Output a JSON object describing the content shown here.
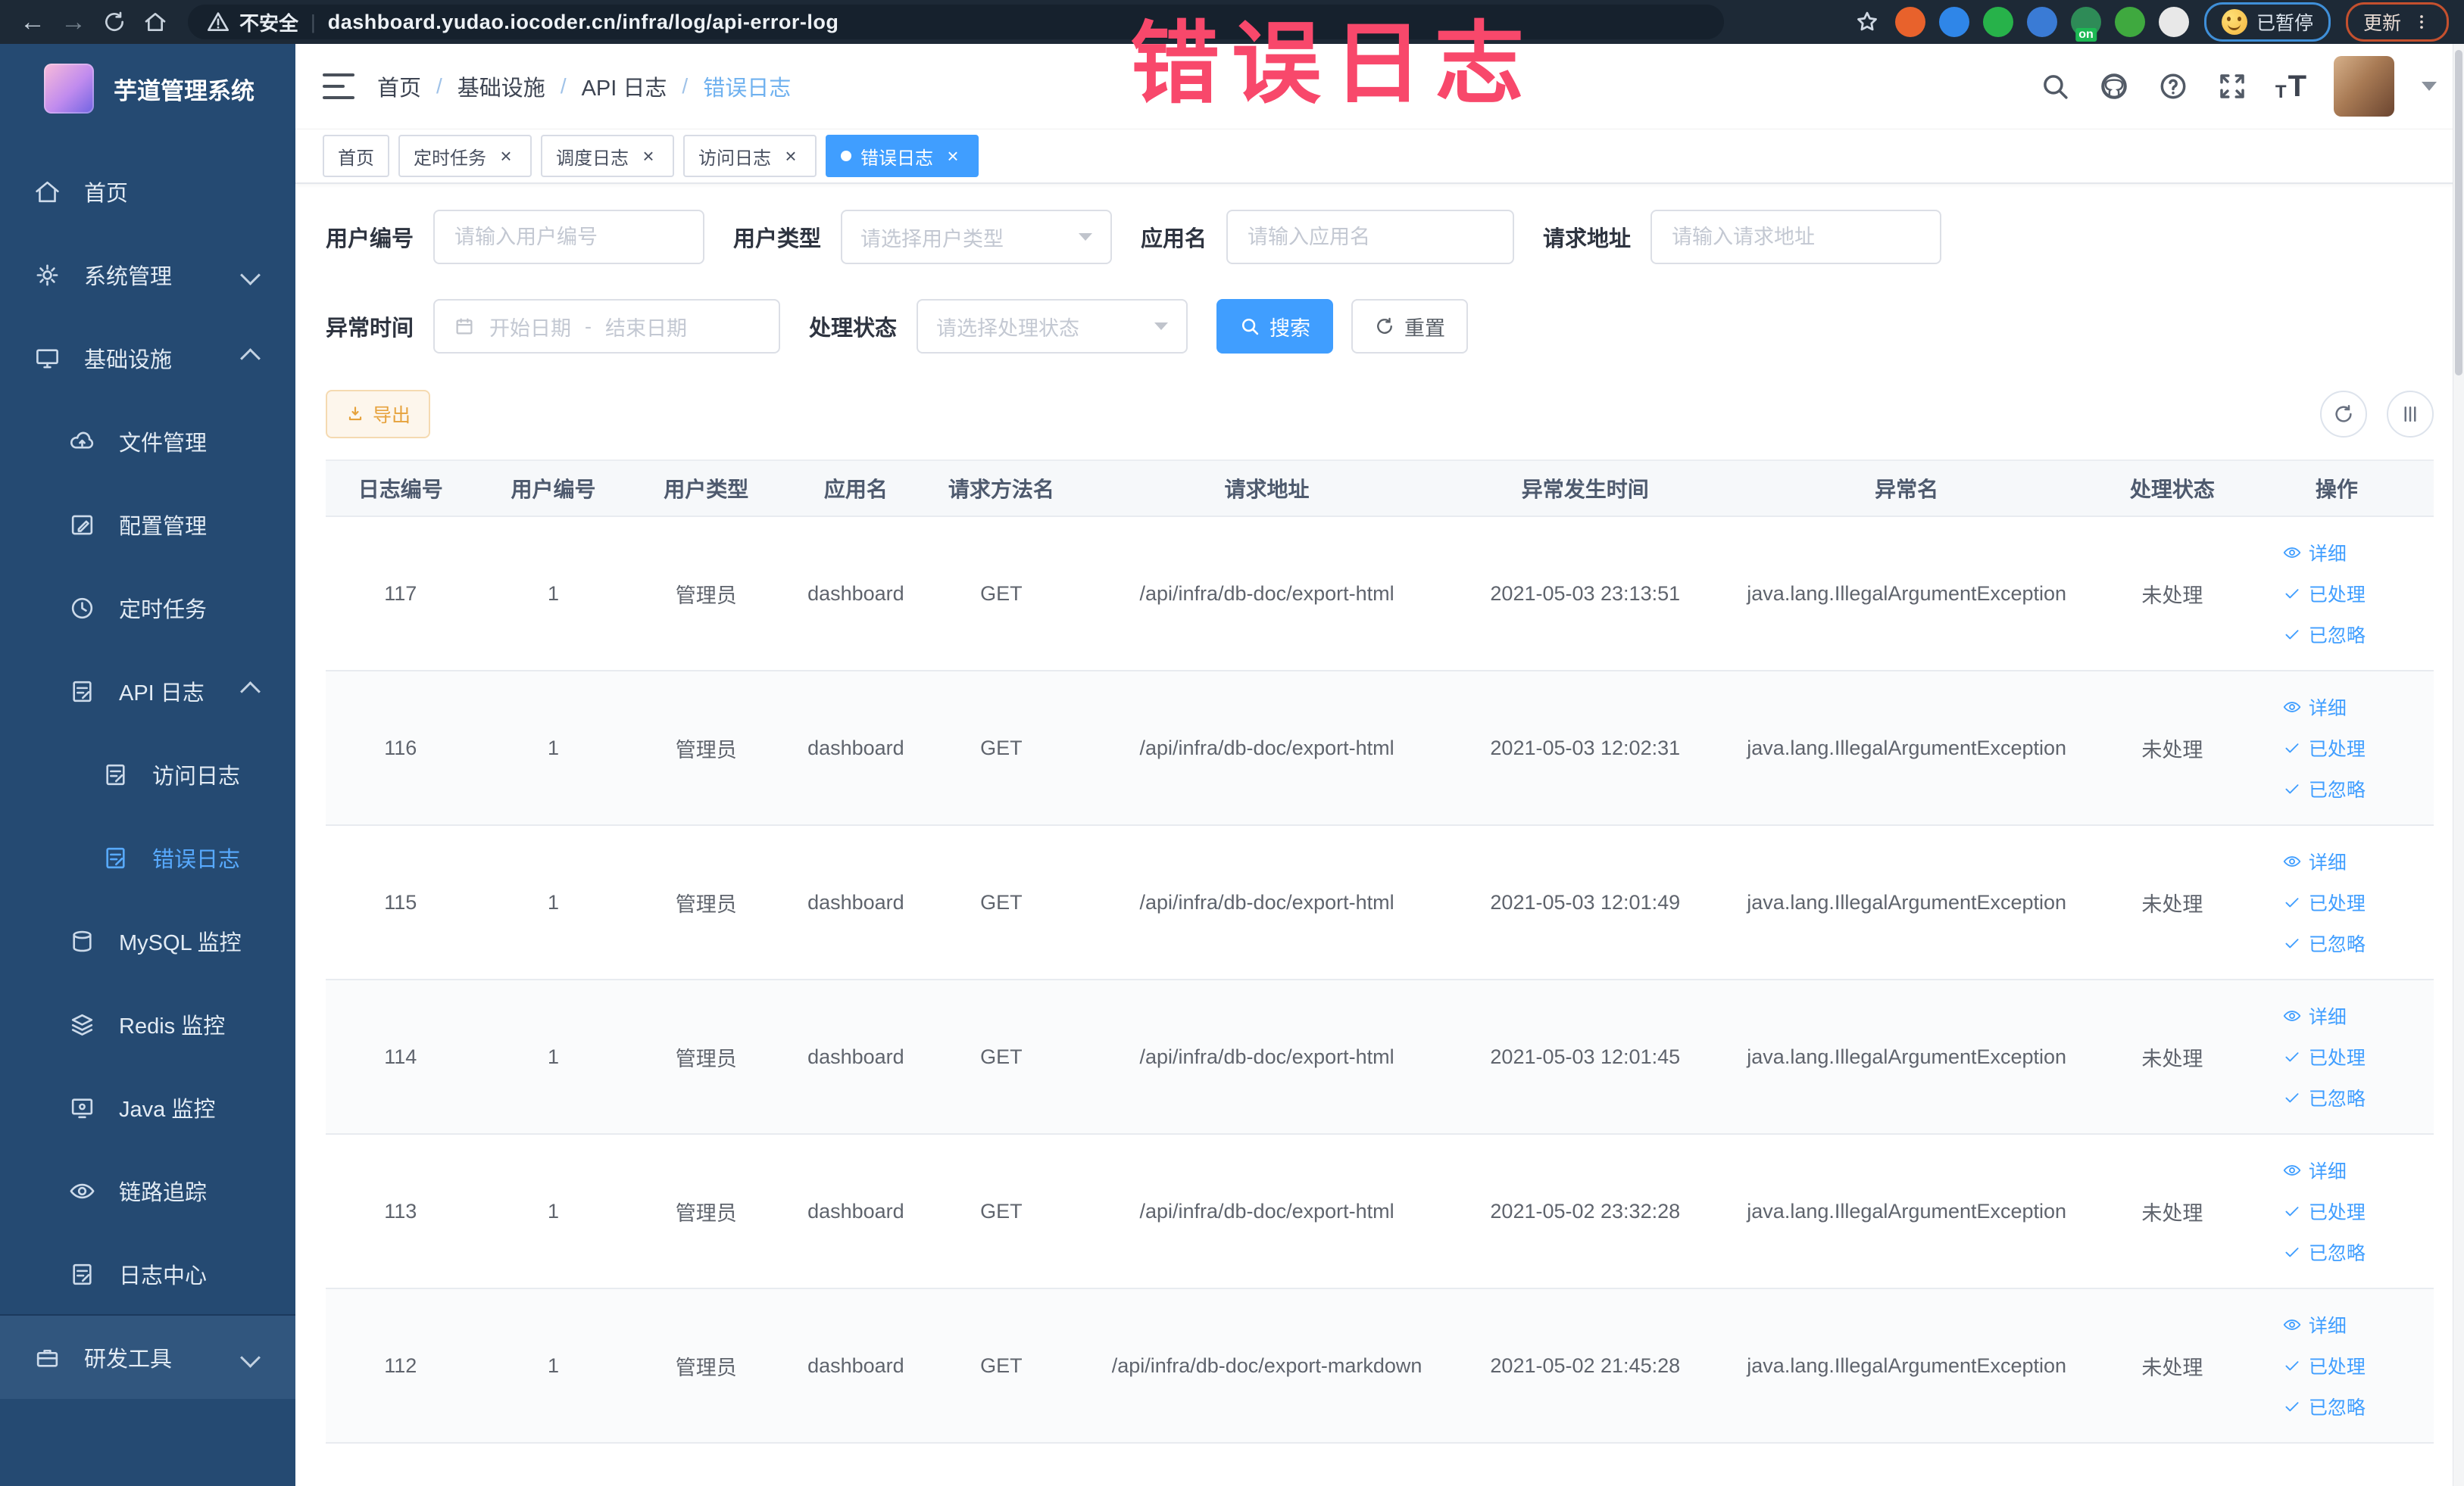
{
  "overlay": {
    "watermark": "错误日志"
  },
  "browser": {
    "security": "不安全",
    "url": "dashboard.yudao.iocoder.cn/infra/log/api-error-log",
    "extensions": [
      {
        "name": "extension-orange-icon",
        "color": "#e8622c"
      },
      {
        "name": "extension-blue-shield-icon",
        "color": "#2f86e8"
      },
      {
        "name": "extension-green-check-icon",
        "color": "#27b24a"
      },
      {
        "name": "extension-blue-grid-icon",
        "color": "#3a7bd5"
      },
      {
        "name": "extension-on-badge-icon",
        "color": "#2e8b57",
        "badge": "on"
      },
      {
        "name": "extension-green-leaf-icon",
        "color": "#3fa93f"
      },
      {
        "name": "extension-puzzle-icon",
        "color": "#e8e8e8"
      }
    ],
    "badges": {
      "paused": "已暂停",
      "update": "更新"
    }
  },
  "sidebar": {
    "logo_title": "芋道管理系统",
    "menu": [
      {
        "id": "home",
        "label": "首页",
        "icon": "home-icon",
        "level": 1
      },
      {
        "id": "system",
        "label": "系统管理",
        "icon": "gear-icon",
        "level": 1,
        "chevron": "down"
      },
      {
        "id": "infra",
        "label": "基础设施",
        "icon": "monitor-icon",
        "level": 1,
        "chevron": "up"
      },
      {
        "id": "file",
        "label": "文件管理",
        "icon": "cloud-upload-icon",
        "level": 2
      },
      {
        "id": "config",
        "label": "配置管理",
        "icon": "edit-icon",
        "level": 2
      },
      {
        "id": "job",
        "label": "定时任务",
        "icon": "clock-icon",
        "level": 2
      },
      {
        "id": "api-log",
        "label": "API 日志",
        "icon": "doc-edit-icon",
        "level": 2,
        "chevron": "up"
      },
      {
        "id": "access-log",
        "label": "访问日志",
        "icon": "doc-edit-icon",
        "level": 3
      },
      {
        "id": "error-log",
        "label": "错误日志",
        "icon": "doc-edit-icon",
        "level": 3,
        "active": true
      },
      {
        "id": "mysql",
        "label": "MySQL 监控",
        "icon": "db-icon",
        "level": 2
      },
      {
        "id": "redis",
        "label": "Redis 监控",
        "icon": "stack-icon",
        "level": 2
      },
      {
        "id": "java",
        "label": "Java 监控",
        "icon": "screen-icon",
        "level": 2
      },
      {
        "id": "trace",
        "label": "链路追踪",
        "icon": "eye-icon",
        "level": 2
      },
      {
        "id": "log-center",
        "label": "日志中心",
        "icon": "doc-edit-icon",
        "level": 2
      },
      {
        "id": "dev-tools",
        "label": "研发工具",
        "icon": "briefcase-icon",
        "level": 1,
        "chevron": "down",
        "highlight": true
      }
    ]
  },
  "header": {
    "breadcrumb": [
      "首页",
      "基础设施",
      "API 日志",
      "错误日志"
    ]
  },
  "tabs": [
    {
      "label": "首页",
      "closable": false,
      "active": false
    },
    {
      "label": "定时任务",
      "closable": true,
      "active": false
    },
    {
      "label": "调度日志",
      "closable": true,
      "active": false
    },
    {
      "label": "访问日志",
      "closable": true,
      "active": false
    },
    {
      "label": "错误日志",
      "closable": true,
      "active": true
    }
  ],
  "filters": {
    "user_id": {
      "label": "用户编号",
      "placeholder": "请输入用户编号"
    },
    "user_type": {
      "label": "用户类型",
      "placeholder": "请选择用户类型"
    },
    "app_name": {
      "label": "应用名",
      "placeholder": "请输入应用名"
    },
    "request_url": {
      "label": "请求地址",
      "placeholder": "请输入请求地址"
    },
    "exception_time": {
      "label": "异常时间",
      "start_placeholder": "开始日期",
      "separator": "-",
      "end_placeholder": "结束日期"
    },
    "process_status": {
      "label": "处理状态",
      "placeholder": "请选择处理状态"
    },
    "search_label": "搜索",
    "reset_label": "重置"
  },
  "toolbar": {
    "export_label": "导出"
  },
  "table": {
    "headers": [
      "日志编号",
      "用户编号",
      "用户类型",
      "应用名",
      "请求方法名",
      "请求地址",
      "异常发生时间",
      "异常名",
      "处理状态",
      "操作"
    ],
    "col_widths": [
      "7.1%",
      "7.4%",
      "7.1%",
      "7.1%",
      "6.7%",
      "18.5%",
      "11.7%",
      "18.8%",
      "6.4%",
      "9.2%"
    ],
    "rows": [
      {
        "log_id": "117",
        "user_id": "1",
        "user_type": "管理员",
        "app_name": "dashboard",
        "method": "GET",
        "request_url": "/api/infra/db-doc/export-html",
        "time": "2021-05-03 23:13:51",
        "exception": "java.lang.IllegalArgumentException",
        "status": "未处理"
      },
      {
        "log_id": "116",
        "user_id": "1",
        "user_type": "管理员",
        "app_name": "dashboard",
        "method": "GET",
        "request_url": "/api/infra/db-doc/export-html",
        "time": "2021-05-03 12:02:31",
        "exception": "java.lang.IllegalArgumentException",
        "status": "未处理"
      },
      {
        "log_id": "115",
        "user_id": "1",
        "user_type": "管理员",
        "app_name": "dashboard",
        "method": "GET",
        "request_url": "/api/infra/db-doc/export-html",
        "time": "2021-05-03 12:01:49",
        "exception": "java.lang.IllegalArgumentException",
        "status": "未处理"
      },
      {
        "log_id": "114",
        "user_id": "1",
        "user_type": "管理员",
        "app_name": "dashboard",
        "method": "GET",
        "request_url": "/api/infra/db-doc/export-html",
        "time": "2021-05-03 12:01:45",
        "exception": "java.lang.IllegalArgumentException",
        "status": "未处理"
      },
      {
        "log_id": "113",
        "user_id": "1",
        "user_type": "管理员",
        "app_name": "dashboard",
        "method": "GET",
        "request_url": "/api/infra/db-doc/export-html",
        "time": "2021-05-02 23:32:28",
        "exception": "java.lang.IllegalArgumentException",
        "status": "未处理"
      },
      {
        "log_id": "112",
        "user_id": "1",
        "user_type": "管理员",
        "app_name": "dashboard",
        "method": "GET",
        "request_url": "/api/infra/db-doc/export-markdown",
        "time": "2021-05-02 21:45:28",
        "exception": "java.lang.IllegalArgumentException",
        "status": "未处理"
      }
    ],
    "row_actions": [
      {
        "label": "详细",
        "icon": "eye-icon"
      },
      {
        "label": "已处理",
        "icon": "check-icon"
      },
      {
        "label": "已忽略",
        "icon": "check-icon"
      }
    ]
  },
  "colors": {
    "primary": "#409eff",
    "warning": "#e6a23c",
    "sidebar_bg": "#254a72",
    "watermark": "#f8486b"
  }
}
